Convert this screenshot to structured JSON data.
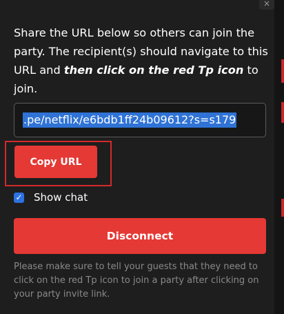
{
  "popup": {
    "close_glyph": "×",
    "instructions": {
      "lead": "Share the URL below so others can join the party. The recipient(s) should navigate to this URL and ",
      "emphasis": "then click on the red Tp icon",
      "tail": " to join."
    },
    "url_value": ".pe/netflix/e6bdb1ff24b09612?s=s179",
    "copy_button_label": "Copy URL",
    "show_chat": {
      "label": "Show chat",
      "checked": true,
      "check_glyph": "✓"
    },
    "disconnect_button_label": "Disconnect",
    "note": "Please make sure to tell your guests that they need to click on the red Tp icon to join a party after clicking on your party invite link."
  },
  "colors": {
    "background": "#1e1e1e",
    "accent_red": "#e53935",
    "selection_blue": "#2f73d6",
    "checkbox_blue": "#2c72e0",
    "annotation_red": "#d42a2a",
    "note_text": "#8a8a8a"
  }
}
